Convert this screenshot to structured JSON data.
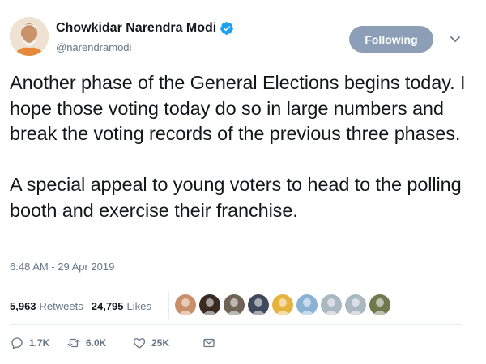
{
  "user": {
    "name": "Chowkidar Narendra Modi",
    "handle": "@narendramodi",
    "verified": true
  },
  "follow_button": {
    "label": "Following"
  },
  "tweet": {
    "text": "Another phase of the General Elections begins today. I hope those voting today do so in large numbers and break the voting records of the previous three phases.\n\nA special appeal to young voters to head to the polling booth and exercise their franchise.",
    "timestamp": "6:48 AM - 29 Apr 2019"
  },
  "stats": {
    "retweets_count": "5,963",
    "retweets_label": "Retweets",
    "likes_count": "24,795",
    "likes_label": "Likes"
  },
  "likers": [
    {
      "color": "#c98f6b"
    },
    {
      "color": "#3a2a22"
    },
    {
      "color": "#6f6356"
    },
    {
      "color": "#3f4b5c"
    },
    {
      "color": "#e7b33f"
    },
    {
      "color": "#8bb2d4"
    },
    {
      "color": "#aab8c2"
    },
    {
      "color": "#aab8c2"
    },
    {
      "color": "#6e7a4e"
    }
  ],
  "actions": {
    "reply_count": "1.7K",
    "retweet_count": "6.0K",
    "like_count": "25K"
  },
  "colors": {
    "text": "#14171a",
    "secondary": "#657786",
    "verified_blue": "#1da1f2",
    "follow_button_bg": "#8c9fb6"
  },
  "icons": [
    "verified-badge-icon",
    "chevron-down-icon",
    "reply-icon",
    "retweet-icon",
    "like-icon",
    "message-icon"
  ]
}
